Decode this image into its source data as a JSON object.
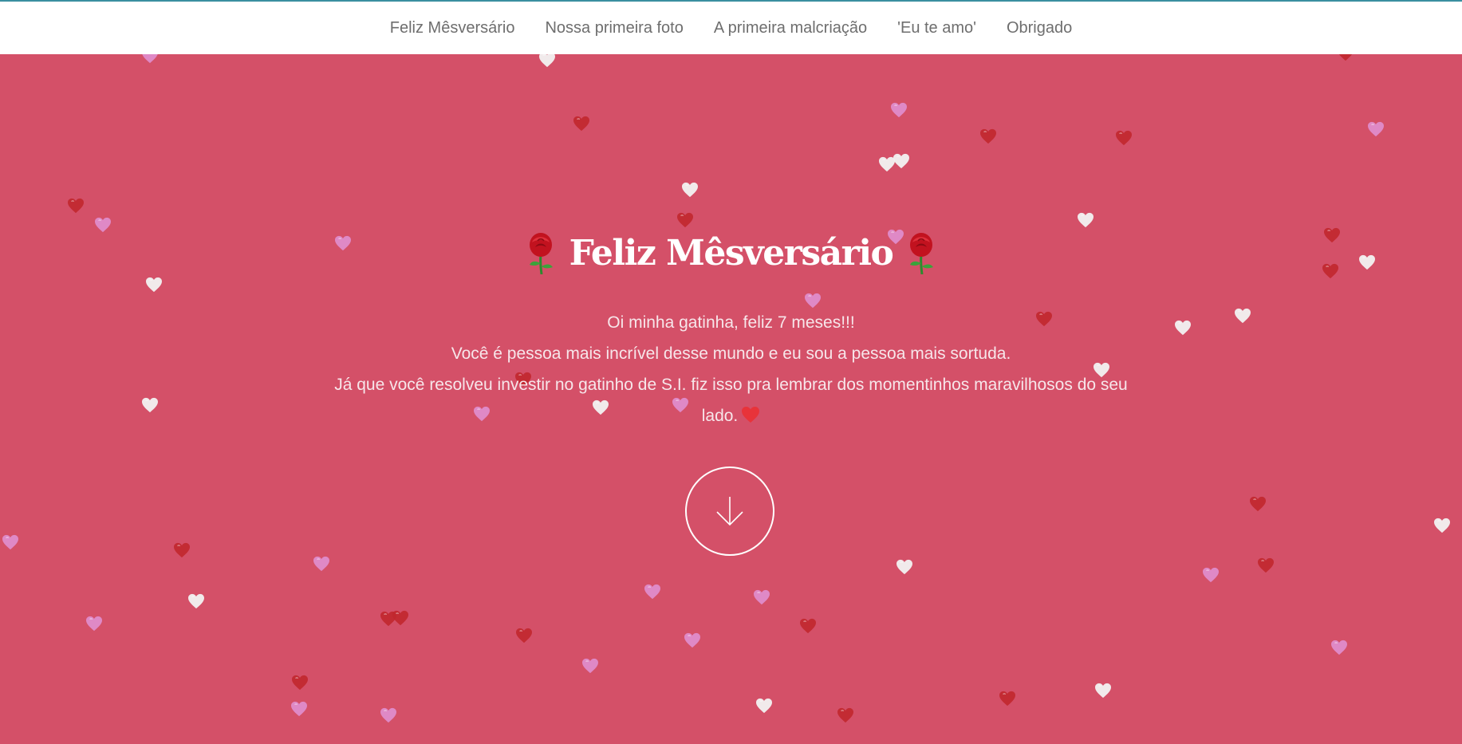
{
  "nav": {
    "items": [
      {
        "label": "Feliz Mêsversário"
      },
      {
        "label": "Nossa primeira foto"
      },
      {
        "label": "A primeira malcriação"
      },
      {
        "label": "'Eu te amo'"
      },
      {
        "label": "Obrigado"
      }
    ]
  },
  "hero": {
    "title": "Feliz Mêsversário",
    "lines": [
      "Oi minha gatinha, feliz 7 meses!!!",
      "Você é pessoa mais incrível desse mundo e eu sou a pessoa mais sortuda.",
      "Já que você resolveu investir no gatinho de S.I. fiz isso pra lembrar dos momentinhos maravilhosos do seu lado."
    ],
    "scroll_icon": "arrow-down-icon",
    "title_icons": [
      "rose-icon",
      "rose-icon"
    ],
    "end_icon": "red-heart-icon"
  },
  "colors": {
    "background": "#d45068",
    "navbar": "#ffffff",
    "nav_text": "#6e6e6e",
    "accent_line": "#3a8fa0",
    "heart_red": "#c1272d",
    "heart_pink": "#e08fd0",
    "heart_white": "#f2f2f2"
  }
}
